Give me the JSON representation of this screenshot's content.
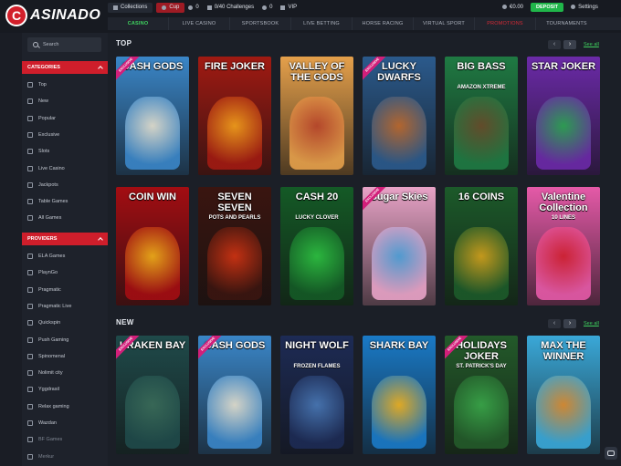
{
  "brand": {
    "logo_letter": "C",
    "logo_text": "ASINADO"
  },
  "topbar": {
    "collections": "Collections",
    "cup": "Cup",
    "stat1": "0",
    "challenges": "0/40 Challenges",
    "stat2": "0",
    "vip": "VIP",
    "balance": "€0.00",
    "deposit": "DEPOSIT",
    "settings": "Settings"
  },
  "nav": [
    "CASINO",
    "LIVE CASINO",
    "SPORTSBOOK",
    "LIVE BETTING",
    "HORSE RACING",
    "VIRTUAL SPORT",
    "PROMOTIONS",
    "TOURNAMENTS"
  ],
  "search": {
    "placeholder": "Search"
  },
  "categories": {
    "title": "CATEGORIES",
    "items": [
      "Top",
      "New",
      "Popular",
      "Exclusive",
      "Slots",
      "Live Casino",
      "Jackpots",
      "Table Games",
      "All Games"
    ]
  },
  "providers": {
    "title": "PROVIDERS",
    "items": [
      "ELA Games",
      "PlaynGo",
      "Pragmatic",
      "Pragmatic Live",
      "Quickspin",
      "Push Gaming",
      "Spinomenal",
      "Nolimit city",
      "Yggdrasil",
      "Relax gaming",
      "Wazdan",
      "BF Games",
      "Merkur"
    ]
  },
  "sections": {
    "top": {
      "title": "TOP",
      "see_all": "See all"
    },
    "new": {
      "title": "NEW",
      "see_all": "See all"
    }
  },
  "top_games": [
    {
      "title": "CASH GODS",
      "sub": "",
      "bg": "#3a86c8",
      "art": "#e7e1cf",
      "ribbon": "EXCLUSIVE"
    },
    {
      "title": "FIRE JOKER",
      "sub": "",
      "bg": "#a11a12",
      "art": "#f4a21c",
      "ribbon": ""
    },
    {
      "title": "VALLEY OF THE GODS",
      "sub": "",
      "bg": "#e5a04b",
      "art": "#b8442a",
      "ribbon": ""
    },
    {
      "title": "LUCKY DWARFS",
      "sub": "",
      "bg": "#2b5a8c",
      "art": "#c26a2a",
      "ribbon": "EXCLUSIVE"
    },
    {
      "title": "BIG BASS",
      "sub": "AMAZON XTREME",
      "bg": "#1f7a43",
      "art": "#6a4b2a",
      "ribbon": ""
    },
    {
      "title": "STAR JOKER",
      "sub": "",
      "bg": "#6b2aa8",
      "art": "#2aa84f",
      "ribbon": ""
    }
  ],
  "row2_games": [
    {
      "title": "COIN WIN",
      "sub": "",
      "bg": "#a30d12",
      "art": "#f0b21a",
      "ribbon": ""
    },
    {
      "title": "SEVEN SEVEN",
      "sub": "POTS AND PEARLS",
      "bg": "#3a1510",
      "art": "#d43412",
      "ribbon": ""
    },
    {
      "title": "CASH 20",
      "sub": "LUCKY CLOVER",
      "bg": "#145a26",
      "art": "#2ec342",
      "ribbon": ""
    },
    {
      "title": "Sugar Skies",
      "sub": "",
      "bg": "#e8a3c7",
      "art": "#4aa0d8",
      "ribbon": "EXCLUSIVE"
    },
    {
      "title": "16 COINS",
      "sub": "",
      "bg": "#1c5a2a",
      "art": "#d6a21c",
      "ribbon": ""
    },
    {
      "title": "Valentine Collection",
      "sub": "10 LINES",
      "bg": "#e55aa8",
      "art": "#d2202f",
      "ribbon": ""
    }
  ],
  "new_games": [
    {
      "title": "KRAKEN BAY",
      "sub": "",
      "bg": "#1f4a4a",
      "art": "#3b6d5a",
      "ribbon": "EXCLUSIVE"
    },
    {
      "title": "CASH GODS",
      "sub": "",
      "bg": "#3a86c8",
      "art": "#e7e1cf",
      "ribbon": "EXCLUSIVE"
    },
    {
      "title": "NIGHT WOLF",
      "sub": "FROZEN FLAMES",
      "bg": "#1d2b55",
      "art": "#4a7ab8",
      "ribbon": ""
    },
    {
      "title": "SHARK BAY",
      "sub": "",
      "bg": "#1a7ac7",
      "art": "#f4b21c",
      "ribbon": ""
    },
    {
      "title": "HOLIDAYS JOKER",
      "sub": "ST. PATRICK'S DAY",
      "bg": "#235a2a",
      "art": "#3aa84a",
      "ribbon": "EXCLUSIVE"
    },
    {
      "title": "MAX THE WINNER",
      "sub": "",
      "bg": "#3aa8d8",
      "art": "#e08a2a",
      "ribbon": ""
    }
  ]
}
